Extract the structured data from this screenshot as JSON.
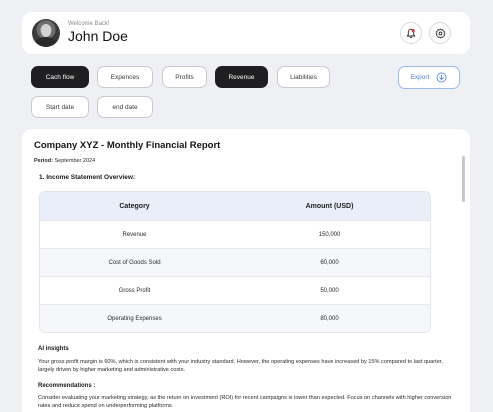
{
  "header": {
    "welcome": "Welcome Back!",
    "user_name": "John Doe",
    "icons": [
      "user-avatar",
      "bell-icon",
      "gear-icon"
    ],
    "notification_color": "#e23b3b"
  },
  "filters": {
    "tabs": [
      {
        "label": "Cach flow",
        "active": true
      },
      {
        "label": "Expences",
        "active": false
      },
      {
        "label": "Profits",
        "active": false
      },
      {
        "label": "Revenue",
        "active": true
      },
      {
        "label": "Liabilities",
        "active": false
      }
    ],
    "start_date": "Start date",
    "end_date": "end date",
    "export_label": "Export",
    "export_color": "#4f7fd8"
  },
  "report": {
    "title": "Company XYZ - Monthly Financial Report",
    "period_label": "Period:",
    "period_value": "September 2024",
    "section_title": "1. Income Statement Overview:",
    "table": {
      "headers": [
        "Category",
        "Amount (USD)"
      ],
      "rows": [
        {
          "category": "Revenue",
          "amount": "150,000"
        },
        {
          "category": "Cost of Goods Sold",
          "amount": "60,000"
        },
        {
          "category": "Gross Profit",
          "amount": "50,000"
        },
        {
          "category": "Operating Expenses",
          "amount": "80,000"
        }
      ]
    },
    "ai_title": "AI insights",
    "ai_text": "Your gross profit margin is 60%, which is consistent with your industry standard. However, the operating expenses have increased by 15% compared to last quarter, largely driven by higher marketing and administrative costs.",
    "rec_title": "Recommendations :",
    "rec_text": "Consider evaluating your marketing strategy, as the return on investment (ROI) for recent campaigns is lower than expected. Focus on channels with higher conversion rates and reduce spend on underperforming platforms."
  }
}
